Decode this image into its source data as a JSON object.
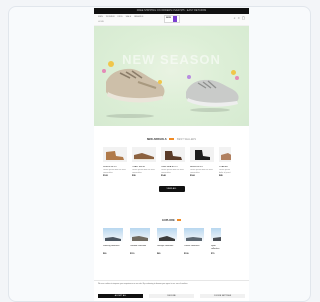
{
  "site": {
    "promo_bar": "FREE SHIPPING ON ORDERS OVER $75 · EASY RETURNS",
    "nav": [
      "MEN",
      "WOMEN",
      "KIDS",
      "SALE",
      "BRANDS"
    ],
    "sub_link": "HOME",
    "logo_text": "NOW",
    "header_icons": [
      "search-icon",
      "user-icon",
      "bag-icon"
    ],
    "hero": {
      "title": "NEW SEASON"
    },
    "colors": {
      "accent": "#f08a24",
      "brand": "#7b3fd0",
      "dark": "#111111",
      "hero_bg": "#ddefd7"
    }
  },
  "new_arrivals": {
    "tab_active": "NEW ARRIVALS",
    "tab_inactive": "BEST SELLERS",
    "products": [
      {
        "name": "SUEDE BOOT",
        "desc": "Lorem ipsum dolor sit amet consectetur",
        "price": "$120"
      },
      {
        "name": "TRAIL SHOE",
        "desc": "Lorem ipsum dolor sit amet consectetur",
        "price": "$95"
      },
      {
        "name": "CHELSEA BOOT",
        "desc": "Lorem ipsum dolor sit amet consectetur",
        "price": "$140"
      },
      {
        "name": "HIKER BOOT",
        "desc": "Lorem ipsum dolor sit amet consectetur",
        "price": "$160"
      },
      {
        "name": "LOAFER",
        "desc": "Lorem ipsum dolor sit amet consectetur",
        "price": "$85"
      }
    ],
    "view_all": "VIEW ALL"
  },
  "categories": {
    "title": "EXPLORE",
    "items": [
      {
        "name": "Running collection",
        "price": "$99"
      },
      {
        "name": "Outdoor collection",
        "price": "$119"
      },
      {
        "name": "Lifestyle collection",
        "price": "$89"
      },
      {
        "name": "Classic collection",
        "price": "$109"
      },
      {
        "name": "Sport collection",
        "price": "$79"
      }
    ]
  },
  "cookie": {
    "text": "We use cookies to improve your experience on our site. By continuing to browse you agree to our use of cookies.",
    "accept": "ACCEPT ALL",
    "decline": "DECLINE",
    "settings": "COOKIE SETTINGS"
  }
}
